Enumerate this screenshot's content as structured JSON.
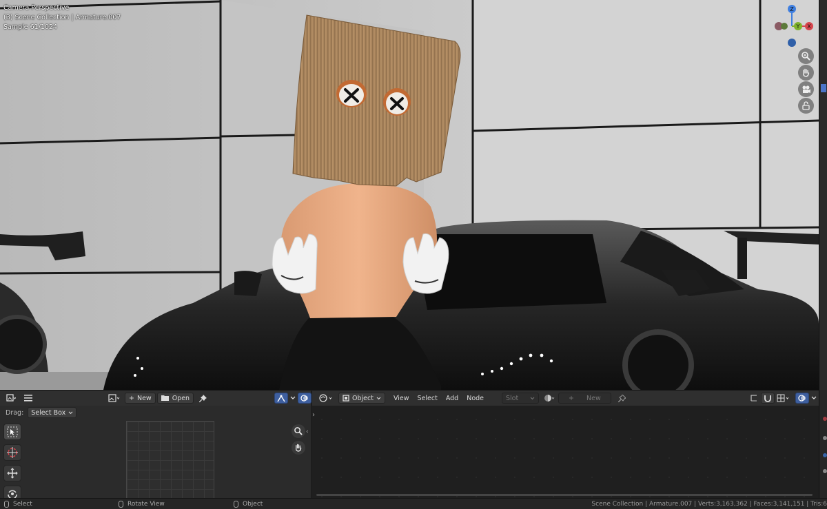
{
  "viewport": {
    "overlay": [
      "Camera Perspective",
      "(3) Scene Collection | Armature.007",
      "Sample 61/1024"
    ],
    "gizmo": {
      "z_label": "Z",
      "y_label": "Y",
      "x_label": "X"
    },
    "nav_icons": [
      "zoom-icon",
      "hand-pan-icon",
      "camera-icon",
      "lock-icon"
    ]
  },
  "image_editor": {
    "header": {
      "new_label": "New",
      "open_label": "Open"
    },
    "drag_label": "Drag:",
    "select_mode": "Select Box",
    "tools": [
      "select-box-icon",
      "cursor-icon",
      "move-icon",
      "rotate-icon"
    ]
  },
  "node_editor": {
    "header": {
      "object_label": "Object",
      "menus": [
        "View",
        "Select",
        "Add",
        "Node"
      ],
      "slot_label": "Slot",
      "new_label": "New"
    }
  },
  "status_bar": {
    "select": "Select",
    "rotate": "Rotate View",
    "object": "Object",
    "stats": "Scene Collection | Armature.007 | Verts:3,163,362 | Faces:3,141,151 | Tris:6"
  },
  "colors": {
    "accent_blue": "#4a74c8",
    "axis_x": "#d6454d",
    "axis_y": "#7fb22d",
    "axis_z": "#3f7fe0"
  }
}
